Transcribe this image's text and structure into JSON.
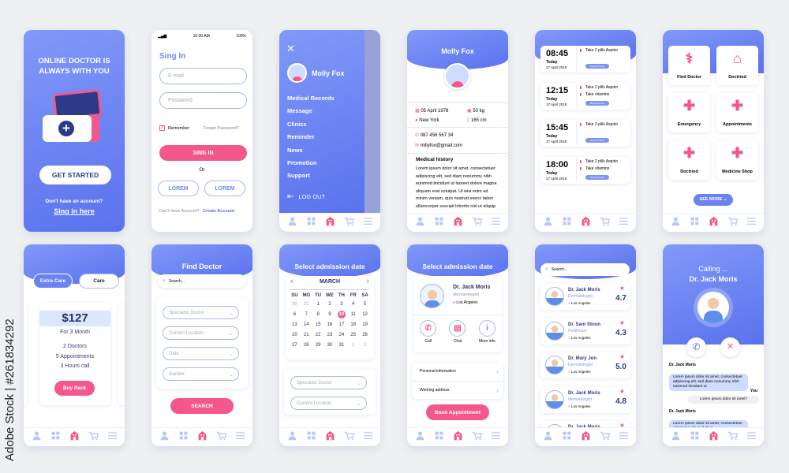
{
  "watermark": {
    "text": "Adobe Stock | #261834292"
  },
  "colors": {
    "primary": "#5a72ee",
    "primary_light": "#8199f8",
    "accent": "#f4588a",
    "dark_text": "#2f2f5f",
    "background": "#eef0f2"
  },
  "nav_icons": [
    "user-icon",
    "grid-icon",
    "home-icon",
    "cart-icon",
    "menu-icon"
  ],
  "welcome": {
    "title_line1": "ONLINE DOCTOR IS",
    "title_line2": "ALWAYS WITH YOU",
    "illustration": "medical-kit-icon",
    "get_started": "GET STARTED",
    "no_account": "Don't have an account?",
    "sign_in_link": "Sing in here"
  },
  "signin": {
    "time": "10:30 AM",
    "battery": "100%",
    "title": "Sing In",
    "email_placeholder": "E-mail",
    "password_placeholder": "Password",
    "remember": "Remember",
    "forgot": "Forget Password?",
    "signin_button": "SING IN",
    "or": "Or",
    "social1": "LOREM",
    "social2": "LOREM",
    "no_account": "Don't have Account?",
    "create": "Create Account"
  },
  "menu": {
    "user": "Molly Fox",
    "items": [
      "Medical Records",
      "Message",
      "Clinics",
      "Reminder",
      "News",
      "Promotion",
      "Support"
    ],
    "logout": "LOG OUT"
  },
  "profile": {
    "name": "Molly Fox",
    "birth": "05 April 1978",
    "weight": "50 kg",
    "city": "New York",
    "height": "165 cm",
    "phone": "087 456 567 34",
    "email": "millyfox@gmail.com",
    "history_title": "Medical history",
    "history_lines": [
      "Lorem ipsum dolor sit amet, consectetuer",
      "adipiscing elit, sed diam nonummy nibh",
      "euismod tincidunt ut laoreet dolore magna",
      "aliquam erat volutpat. Ut wisi enim ad",
      "minim veniam, quis nostrud exerci tation",
      "ullamcorper suscipit lobortis nisl ut aliquip"
    ]
  },
  "reminders": [
    {
      "time": "08:45",
      "day": "Today",
      "date": "17 April 2019",
      "tasks": [
        "Take 2 pills Aspirin"
      ],
      "badge": "Repeat Never"
    },
    {
      "time": "12:15",
      "day": "Today",
      "date": "17 April 2019",
      "tasks": [
        "Take 2 pills Aspirin",
        "Take vitamins"
      ],
      "badge": "Repeat Never"
    },
    {
      "time": "15:45",
      "day": "Today",
      "date": "17 April 2019",
      "tasks": [
        "Take 2 pills Aspirin"
      ],
      "badge": "Repeat Never"
    },
    {
      "time": "18:00",
      "day": "Today",
      "date": "17 April 2019",
      "tasks": [
        "Take 2 pills Aspirin",
        "Take vitamins"
      ],
      "badge": "Repeat Never"
    }
  ],
  "services": {
    "items": [
      {
        "label": "Find Doctor",
        "icon": "doctor-icon"
      },
      {
        "label": "Doctriod",
        "icon": "hospital-icon"
      },
      {
        "label": "Emergency",
        "icon": "ambulance-icon"
      },
      {
        "label": "Appointments",
        "icon": "clipboard-icon"
      },
      {
        "label": "Doctriod",
        "icon": "first-aid-kit-icon"
      },
      {
        "label": "Medicine Shop",
        "icon": "pills-icon"
      }
    ],
    "see_more": "SEE MORE"
  },
  "plans": {
    "tab1": "Extra Care",
    "tab2": "Care",
    "price": "$127",
    "period": "For 3 Month",
    "features": [
      "2 Doctors",
      "5 Appointments",
      "3 Hours call"
    ],
    "buy": "Buy Pack"
  },
  "find": {
    "title": "Find Doctor",
    "search_placeholder": "Search...",
    "selects": [
      "Specialist Doctor",
      "Current Location",
      "Date",
      "Gander"
    ],
    "search_button": "SEARCH"
  },
  "calendar": {
    "title": "Select admission date",
    "month": "MARCH",
    "weekdays": [
      "SU",
      "MO",
      "TU",
      "WE",
      "TH",
      "FR",
      "SA"
    ],
    "days": [
      "30",
      "31",
      "1",
      "2",
      "3",
      "4",
      "5",
      "6",
      "7",
      "8",
      "9",
      "10",
      "11",
      "12",
      "13",
      "14",
      "15",
      "16",
      "17",
      "18",
      "19",
      "20",
      "21",
      "22",
      "23",
      "24",
      "25",
      "26",
      "27",
      "28",
      "29",
      "30",
      "31",
      "1",
      "2"
    ],
    "selected": "10",
    "selects": [
      "Specialist Doctor",
      "Current Location"
    ]
  },
  "doctor": {
    "title": "Select admission date",
    "name": "Dr. Jack Moris",
    "specialty": "dermatologist",
    "location": "Los Angeles",
    "actions": [
      "Call",
      "Chat",
      "More info"
    ],
    "rows": [
      "Personal information",
      "Working address"
    ],
    "book": "Book Appointment"
  },
  "doctors": {
    "search_placeholder": "Search...",
    "items": [
      {
        "name": "Dr. Jack Moris",
        "specialty": "Dermatologist",
        "location": "Los Angeles",
        "rating": "4.7"
      },
      {
        "name": "Dr. Sam Stoun",
        "specialty": "Pedifricain",
        "location": "Los Angeles",
        "rating": "4.3"
      },
      {
        "name": "Dr. Mary Jon",
        "specialty": "Dermatologist",
        "location": "Los Angeles",
        "rating": "5.0"
      },
      {
        "name": "Dr. Jack Moris",
        "specialty": "dermatologist",
        "location": "Los Angeles",
        "rating": "4.8"
      },
      {
        "name": "Dr. Jack Moris",
        "specialty": "",
        "location": "",
        "rating": ""
      }
    ]
  },
  "call": {
    "status": "Calling ...",
    "name": "Dr. Jack Moris",
    "messages": [
      {
        "sender": "Dr. Jack Moris",
        "text": "Lorem ipsum dolor sit amet, consectetuer adipiscing elit, sed diam nonummy nibh euismod tincidunt ut"
      },
      {
        "sender": "You",
        "text": "Lorem ipsum dolor sit amet?"
      },
      {
        "sender": "Dr. Jack Moris",
        "text": "Lorem ipsum dolor sit amet, consectetuer adipiscing elit, sed diam"
      }
    ]
  }
}
